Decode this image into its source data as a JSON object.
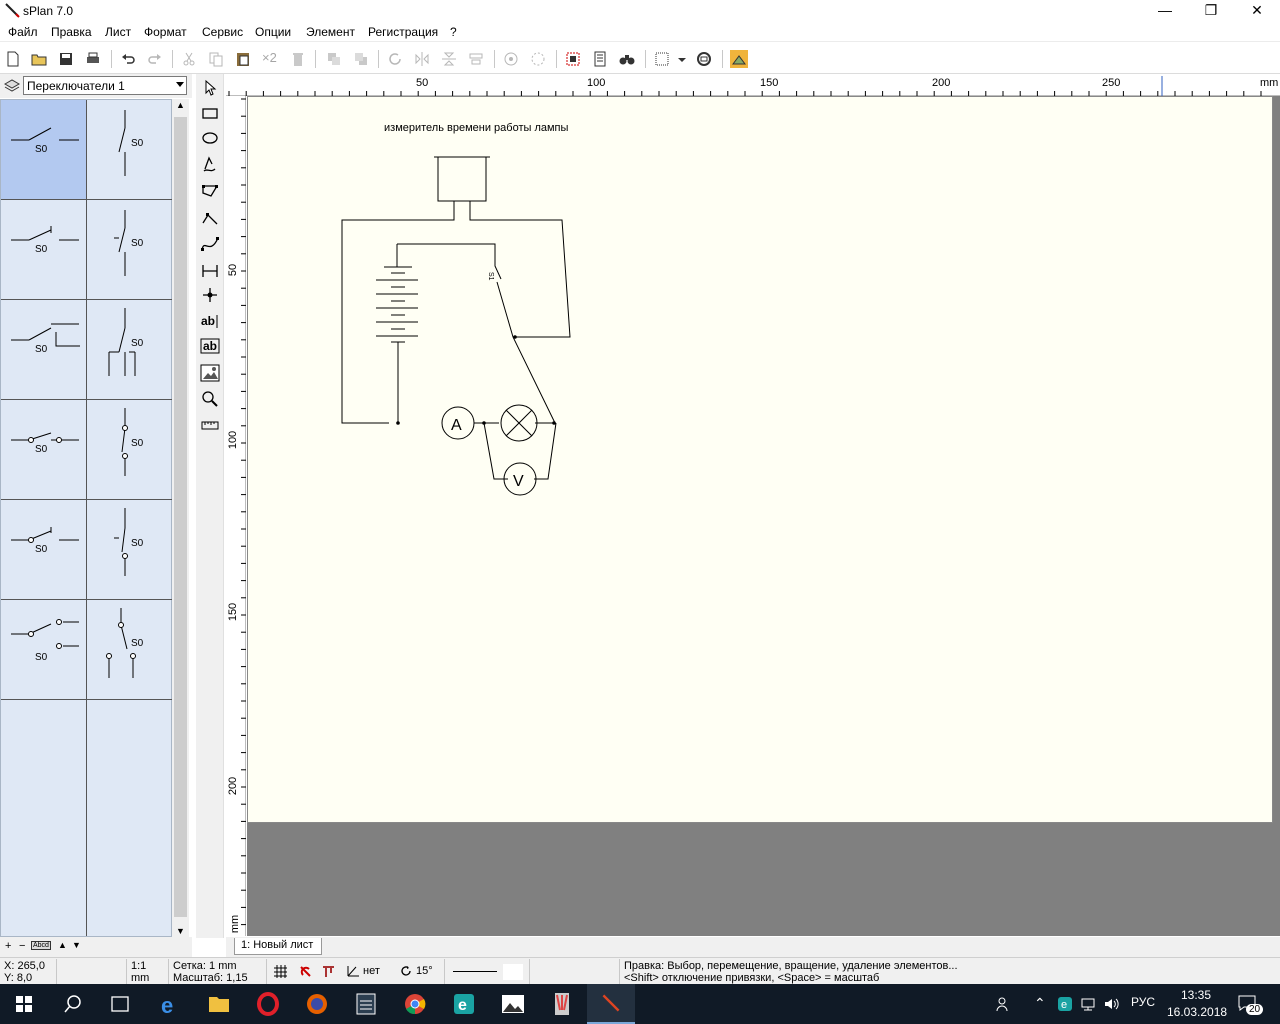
{
  "window": {
    "title": "sPlan 7.0",
    "minimize": "—",
    "maximize": "❐",
    "close": "✕"
  },
  "menu": [
    "Файл",
    "Правка",
    "Лист",
    "Формат",
    "Сервис",
    "Опции",
    "Элемент",
    "Регистрация",
    "?"
  ],
  "toolbar": {
    "copies_label": "×2"
  },
  "library": {
    "selected": "Переключатели 1",
    "symbol_label": "S0",
    "scroll_up": "▲",
    "scroll_down": "▼",
    "bottom_controls": [
      "+",
      "−",
      "Abcd",
      "▲",
      "▼"
    ]
  },
  "draw_tools": [
    "pointer",
    "rectangle",
    "ellipse",
    "freehand",
    "polygon",
    "polyline",
    "bezier",
    "dimension",
    "junction",
    "text",
    "textframe",
    "image",
    "zoom",
    "measure"
  ],
  "ruler": {
    "unit": "mm",
    "top_labels": [
      "50",
      "100",
      "150",
      "200",
      "250"
    ],
    "left_labels": [
      "50",
      "100",
      "150",
      "200"
    ],
    "corner_unit": "mm"
  },
  "drawing": {
    "title": "измеритель времени работы лампы",
    "ammeter": "A",
    "voltmeter": "V",
    "switch_label": "S1"
  },
  "sheet_tab": "1: Новый лист",
  "status": {
    "x": "X: 265,0",
    "y": "Y: 8,0",
    "scale_ratio": "1:1",
    "scale_unit": "mm",
    "grid": "Сетка: 1 mm",
    "zoom": "Масштаб:  1,15",
    "snap": "нет",
    "angle": "15°",
    "hint1": "Правка: Выбор, перемещение, вращение, удаление элементов...",
    "hint2": "<Shift> отключение привязки, <Space> = масштаб"
  },
  "taskbar": {
    "time": "13:35",
    "date": "16.03.2018",
    "lang": "РУС",
    "notifications": "20"
  },
  "colors": {
    "sheet": "#fffff4",
    "canvas": "#808080",
    "library": "#dfe8f5",
    "selected_cell": "#b3c9f0",
    "taskbar": "#101a26"
  }
}
